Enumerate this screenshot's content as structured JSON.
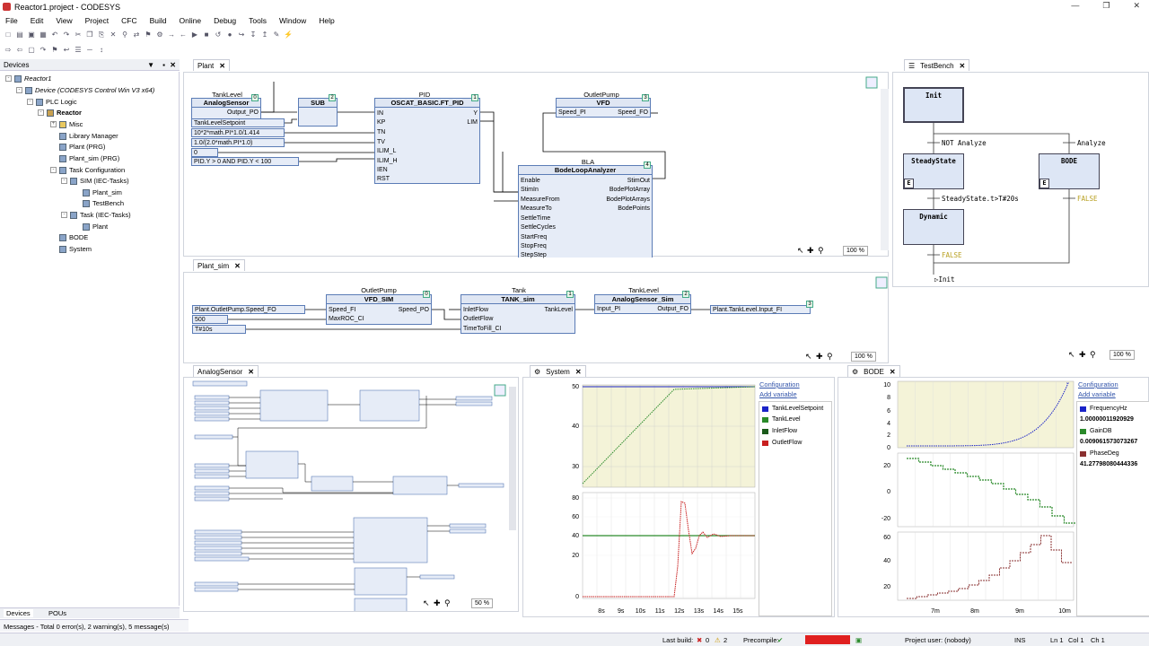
{
  "window": {
    "title": "Reactor1.project - CODESYS"
  },
  "menu": [
    "File",
    "Edit",
    "View",
    "Project",
    "CFC",
    "Build",
    "Online",
    "Debug",
    "Tools",
    "Window",
    "Help"
  ],
  "devices": {
    "title": "Devices",
    "tree": [
      "Reactor1",
      "Device (CODESYS Control Win V3 x64)",
      "PLC Logic",
      "Reactor",
      "Misc",
      "Library Manager",
      "Plant (PRG)",
      "Plant_sim (PRG)",
      "Task Configuration",
      "SIM (IEC-Tasks)",
      "Plant_sim",
      "TestBench",
      "Task (IEC-Tasks)",
      "Plant",
      "BODE",
      "System"
    ],
    "bottom_tabs": [
      "Devices",
      "POUs"
    ]
  },
  "plant": {
    "tab": "Plant",
    "blocks": {
      "tanklevel_inst": "TankLevel",
      "analog_type": "AnalogSensor",
      "analog_out": "Output_PO",
      "analog_num": "0",
      "sub_type": "SUB",
      "sub_num": "2",
      "pid_inst": "PID",
      "pid_type": "OSCAT_BASIC.FT_PID",
      "pid_num": "1",
      "pid_pins_in": [
        "IN",
        "KP",
        "TN",
        "TV",
        "ILIM_L",
        "ILIM_H",
        "IEN",
        "RST"
      ],
      "pid_pins_out": [
        "Y",
        "LIM"
      ],
      "vfd_inst": "OutletPump",
      "vfd_type": "VFD",
      "vfd_num": "3",
      "vfd_in": "Speed_PI",
      "vfd_out": "Speed_FO",
      "bla_inst": "BLA",
      "bla_type": "BodeLoopAnalyzer",
      "bla_num": "4",
      "bla_in": [
        "Enable",
        "StimIn",
        "MeasureFrom",
        "MeasureTo",
        "SettleTime",
        "SettleCycles",
        "StartFreq",
        "StopFreq",
        "StepStep"
      ],
      "bla_out": [
        "StimOut",
        "BodePlotArray",
        "BodePlotArrays",
        "BodePoints"
      ]
    },
    "inputs": [
      "TankLevelSetpoint",
      "10*2*math.PI*1.0/1.414",
      "1.0/(2.0*math.PI*1.0)",
      "0",
      "PID.Y > 0 AND PID.Y < 100"
    ],
    "zoom": "100 %"
  },
  "testbench": {
    "tab": "TestBench",
    "steps": [
      "Init",
      "SteadyState",
      "BODE",
      "Dynamic"
    ],
    "transitions": [
      "NOT Analyze",
      "Analyze",
      "SteadyState.t>T#20s",
      "FALSE",
      "FALSE"
    ],
    "jump": "Init",
    "action_marker": "E"
  },
  "plantsim": {
    "tab": "Plant_sim",
    "vfd_inst": "OutletPump",
    "vfd_type": "VFD_SIM",
    "vfd_num": "0",
    "vfd_in": [
      "Speed_FI",
      "MaxROC_CI"
    ],
    "vfd_out": "Speed_PO",
    "tank_inst": "Tank",
    "tank_type": "TANK_sim",
    "tank_num": "1",
    "tank_in": [
      "InletFlow",
      "OutletFlow",
      "TimeToFill_CI"
    ],
    "tank_out": "TankLevel",
    "as_inst": "TankLevel",
    "as_type": "AnalogSensor_Sim",
    "as_num": "2",
    "as_in": "Input_PI",
    "as_out": "Output_FO",
    "out_num": "3",
    "inputs": [
      "Plant.OutletPump.Speed_FO",
      "500",
      "T#10s"
    ],
    "output": "Plant.TankLevel.Input_FI",
    "zoom": "100 %"
  },
  "analogsensor": {
    "tab": "AnalogSensor",
    "zoom": "50 %"
  },
  "system": {
    "tab": "System",
    "links": [
      "Configuration",
      "Add variable"
    ],
    "legend": [
      {
        "name": "TankLevelSetpoint",
        "color": "#1a23c8"
      },
      {
        "name": "TankLevel",
        "color": "#2a8a2a"
      },
      {
        "name": "InletFlow",
        "color": "#1a5a1a"
      },
      {
        "name": "OutletFlow",
        "color": "#c82020"
      }
    ],
    "top_y_ticks": [
      "50",
      "40",
      "30"
    ],
    "bottom_y_ticks": [
      "80",
      "60",
      "40",
      "20",
      "0"
    ],
    "x_ticks": [
      "8s",
      "9s",
      "10s",
      "11s",
      "12s",
      "13s",
      "14s",
      "15s"
    ]
  },
  "bode": {
    "tab": "BODE",
    "links": [
      "Configuration",
      "Add variable"
    ],
    "legend": [
      {
        "name": "FrequencyHz",
        "value": "1.00000011920929",
        "color": "#1a23c8"
      },
      {
        "name": "GainDB",
        "value": "0.009061573073267",
        "color": "#2a8a2a"
      },
      {
        "name": "PhaseDeg",
        "value": "41.27798080444336",
        "color": "#8a3030"
      }
    ],
    "top_y_ticks": [
      "10",
      "8",
      "6",
      "4",
      "2",
      "0"
    ],
    "mid_y_ticks": [
      "20",
      "0",
      "-20"
    ],
    "bot_y_ticks": [
      "60",
      "40",
      "20"
    ],
    "x_ticks": [
      "7m",
      "8m",
      "9m",
      "10m"
    ]
  },
  "status": {
    "messages": "Messages - Total 0 error(s), 2 warning(s), 5 message(s)",
    "last_build": "Last build:",
    "errors": "0",
    "warnings": "2",
    "precompile": "Precompile:",
    "user": "Project user: (nobody)",
    "ins": "INS",
    "ln": "Ln 1",
    "col": "Col 1",
    "ch": "Ch 1"
  }
}
